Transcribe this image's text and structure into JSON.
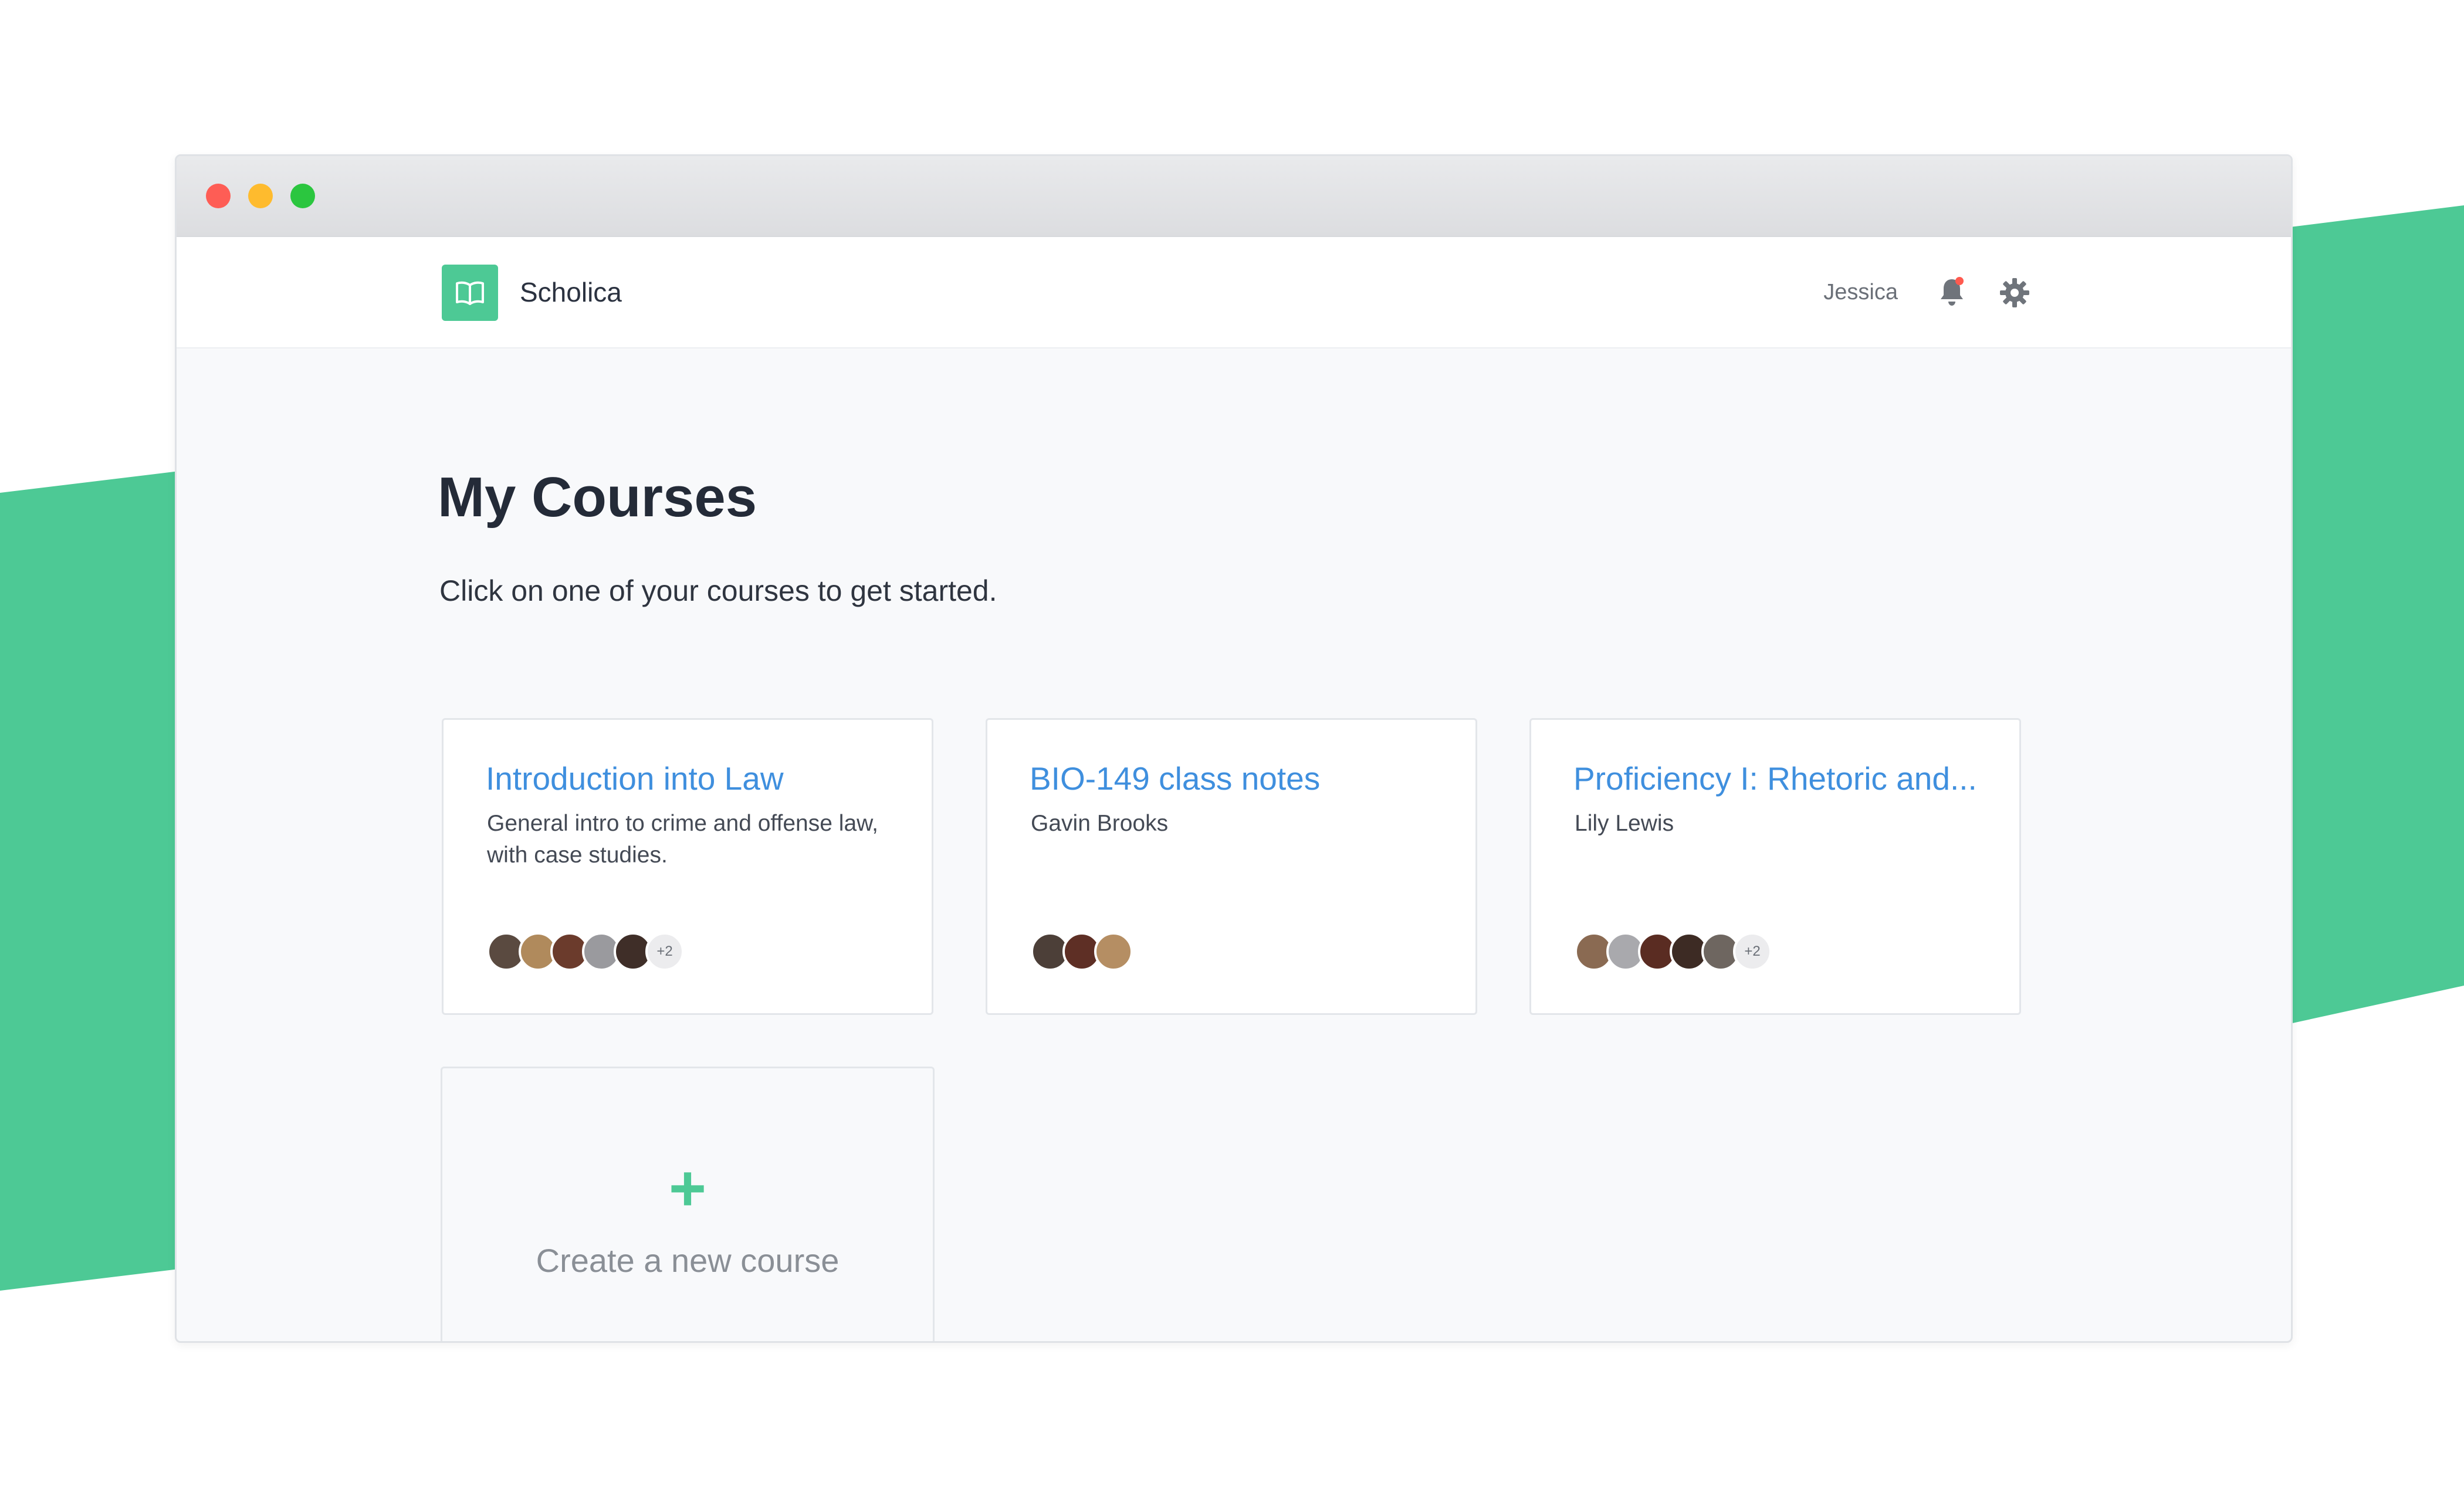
{
  "app": {
    "brand": "Scholica",
    "user_name": "Jessica",
    "accent_color": "#4dc995",
    "link_color": "#3f8fde"
  },
  "icons": {
    "logo": "open-book-icon",
    "notifications": "bell-icon",
    "settings": "gear-icon",
    "create": "plus-icon"
  },
  "page": {
    "title": "My Courses",
    "subtitle": "Click on one of your courses to get started."
  },
  "courses": [
    {
      "title": "Introduction into Law",
      "description": "General intro to crime and offense law, with case studies.",
      "avatars": 5,
      "more_count": "+2"
    },
    {
      "title": "BIO-149 class notes",
      "description": "Gavin Brooks",
      "avatars": 3,
      "more_count": ""
    },
    {
      "title": "Proficiency I: Rhetoric and...",
      "description": "Lily Lewis",
      "avatars": 5,
      "more_count": "+2"
    }
  ],
  "create_course": {
    "label": "Create a new course",
    "icon_glyph": "+"
  }
}
